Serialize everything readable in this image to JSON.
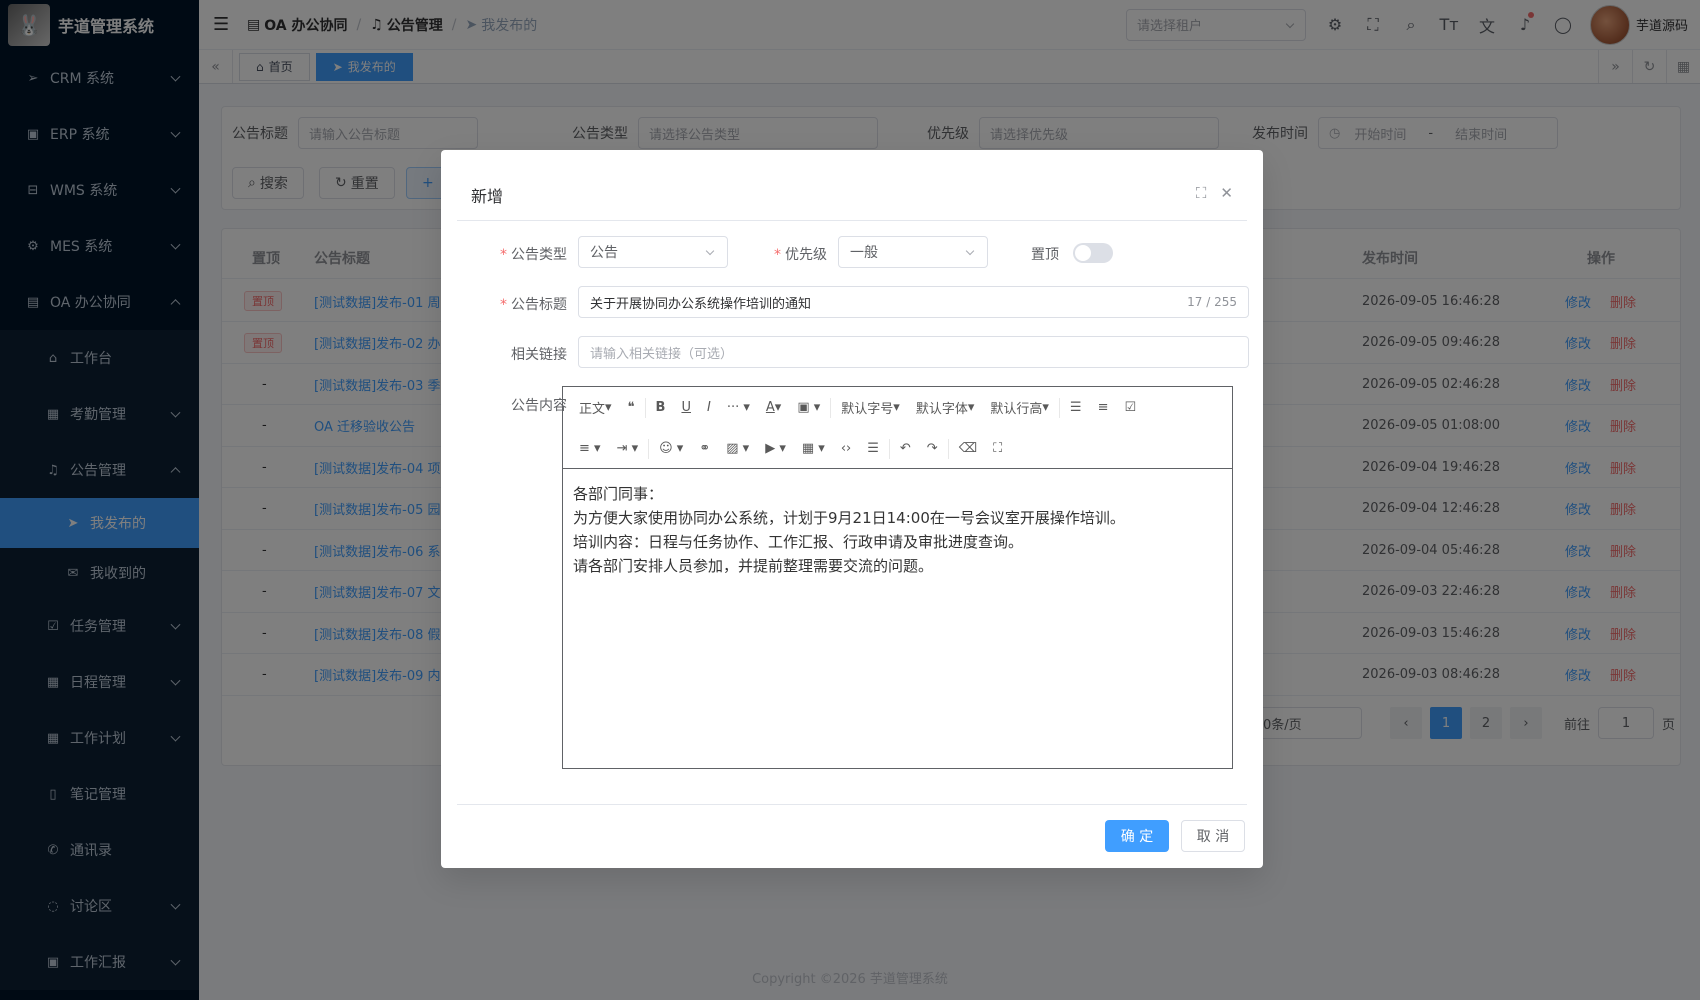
{
  "app": {
    "title": "芋道管理系统"
  },
  "sidebar": {
    "items": [
      {
        "label": "CRM 系统",
        "icon": "send-icon"
      },
      {
        "label": "ERP 系统",
        "icon": "erp-icon"
      },
      {
        "label": "WMS 系统",
        "icon": "cart-icon"
      },
      {
        "label": "MES 系统",
        "icon": "gear-icon"
      },
      {
        "label": "OA 办公协同",
        "icon": "building-icon"
      }
    ],
    "oa_sub": [
      {
        "label": "工作台",
        "icon": "home-icon"
      },
      {
        "label": "考勤管理",
        "icon": "calendar-icon"
      },
      {
        "label": "公告管理",
        "icon": "bell-icon"
      }
    ],
    "notice_sub": [
      {
        "label": "我发布的",
        "icon": "send-icon"
      },
      {
        "label": "我收到的",
        "icon": "mail-icon"
      }
    ],
    "oa_sub2": [
      {
        "label": "任务管理",
        "icon": "clipboard-icon"
      },
      {
        "label": "日程管理",
        "icon": "calendar-icon"
      },
      {
        "label": "工作计划",
        "icon": "calendar-icon"
      },
      {
        "label": "笔记管理",
        "icon": "book-icon"
      },
      {
        "label": "通讯录",
        "icon": "phone-icon"
      },
      {
        "label": "讨论区",
        "icon": "chat-icon"
      },
      {
        "label": "工作汇报",
        "icon": "report-icon"
      }
    ]
  },
  "navbar": {
    "crumbs": [
      "OA 办公协同",
      "公告管理",
      "我发布的"
    ],
    "tenant_placeholder": "请选择租户",
    "user": "芋道源码"
  },
  "tags": [
    "首页",
    "我发布的"
  ],
  "search": {
    "title_label": "公告标题",
    "title_placeholder": "请输入公告标题",
    "type_label": "公告类型",
    "type_placeholder": "请选择公告类型",
    "priority_label": "优先级",
    "priority_placeholder": "请选择优先级",
    "time_label": "发布时间",
    "start_placeholder": "开始时间",
    "end_placeholder": "结束时间",
    "dash": "-",
    "search_btn": "搜索",
    "reset_btn": "重置",
    "add_btn": "+"
  },
  "table": {
    "headers": {
      "pin": "置顶",
      "title": "公告标题",
      "time": "发布时间",
      "ops": "操作"
    },
    "edit": "修改",
    "delete": "删除",
    "rows": [
      {
        "pin": "置顶",
        "title": "[测试数据]发布-01 周",
        "time": "2026-09-05 16:46:28"
      },
      {
        "pin": "置顶",
        "title": "[测试数据]发布-02 办",
        "time": "2026-09-05 09:46:28"
      },
      {
        "pin": "-",
        "title": "[测试数据]发布-03 季",
        "time": "2026-09-05 02:46:28"
      },
      {
        "pin": "-",
        "title": "OA 迁移验收公告",
        "time": "2026-09-05 01:08:00"
      },
      {
        "pin": "-",
        "title": "[测试数据]发布-04 项",
        "time": "2026-09-04 19:46:28"
      },
      {
        "pin": "-",
        "title": "[测试数据]发布-05 园",
        "time": "2026-09-04 12:46:28"
      },
      {
        "pin": "-",
        "title": "[测试数据]发布-06 系",
        "time": "2026-09-04 05:46:28"
      },
      {
        "pin": "-",
        "title": "[测试数据]发布-07 文",
        "time": "2026-09-03 22:46:28"
      },
      {
        "pin": "-",
        "title": "[测试数据]发布-08 假",
        "time": "2026-09-03 15:46:28"
      },
      {
        "pin": "-",
        "title": "[测试数据]发布-09 内",
        "time": "2026-09-03 08:46:28"
      }
    ]
  },
  "pager": {
    "size": "0条/页",
    "pages": [
      "1",
      "2"
    ],
    "goto": "前往",
    "goto_value": "1",
    "page_unit": "页"
  },
  "copyright": "Copyright ©2026 芋道管理系统",
  "dialog": {
    "title": "新增",
    "type_label": "公告类型",
    "type_value": "公告",
    "priority_label": "优先级",
    "priority_value": "一般",
    "pin_label": "置顶",
    "title_label": "公告标题",
    "title_value": "关于开展协同办公系统操作培训的通知",
    "title_count": "17 / 255",
    "link_label": "相关链接",
    "link_placeholder": "请输入相关链接（可选）",
    "content_label": "公告内容",
    "toolbar": {
      "heading": "正文",
      "font_size": "默认字号",
      "font_family": "默认字体",
      "line_height": "默认行高"
    },
    "content": [
      "各部门同事：",
      "为方便大家使用协同办公系统，计划于9月21日14:00在一号会议室开展操作培训。",
      "培训内容：日程与任务协作、工作汇报、行政申请及审批进度查询。",
      "请各部门安排人员参加，并提前整理需要交流的问题。"
    ],
    "ok": "确 定",
    "cancel": "取 消"
  },
  "colors": {
    "primary": "#409eff",
    "sidebar": "#001529",
    "danger": "#f56c6c"
  }
}
